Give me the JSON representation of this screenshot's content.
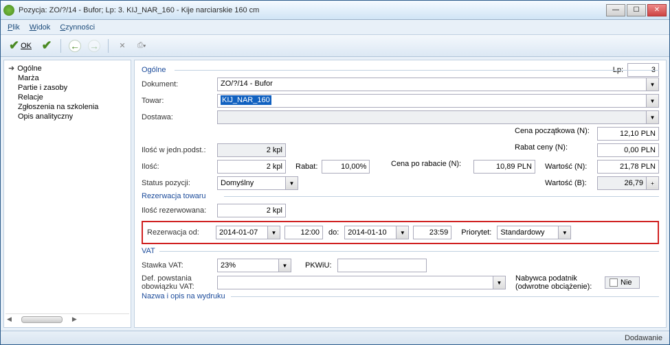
{
  "title": "Pozycja: ZO/?/14 - Bufor; Lp: 3. KIJ_NAR_160 - Kije narciarskie 160 cm",
  "menu": {
    "plik": "Plik",
    "widok": "Widok",
    "czynnosci": "Czynności"
  },
  "toolbar": {
    "ok": "OK"
  },
  "sidebar": {
    "items": [
      {
        "label": "Ogólne",
        "selected": true
      },
      {
        "label": "Marża"
      },
      {
        "label": "Partie i zasoby"
      },
      {
        "label": "Relacje"
      },
      {
        "label": "Zgłoszenia na szkolenia"
      },
      {
        "label": "Opis analityczny"
      }
    ]
  },
  "section": {
    "ogolne": "Ogólne",
    "rezerwacja": "Rezerwacja towaru",
    "vat": "VAT",
    "nazwa": "Nazwa i opis na wydruku"
  },
  "labels": {
    "lp": "Lp:",
    "dokument": "Dokument:",
    "towar": "Towar:",
    "dostawa": "Dostawa:",
    "ilosc_jedn": "Ilość w jedn.podst.:",
    "ilosc": "Ilość:",
    "rabat": "Rabat:",
    "status": "Status pozycji:",
    "cena_pocz": "Cena początkowa (N):",
    "rabat_ceny": "Rabat ceny (N):",
    "cena_po": "Cena po rabacie (N):",
    "wartosc_n": "Wartość (N):",
    "wartosc_b": "Wartość (B):",
    "ilosc_rez": "Ilość rezerwowana:",
    "rez_od": "Rezerwacja od:",
    "do": "do:",
    "priorytet": "Priorytet:",
    "stawka": "Stawka VAT:",
    "pkwiu": "PKWiU:",
    "def_vat": "Def. powstania obowiązku VAT:",
    "nabywca": "Nabywca podatnik (odwrotne obciążenie):",
    "nie": "Nie"
  },
  "values": {
    "lp": "3",
    "dokument": "ZO/?/14 - Bufor",
    "towar": "KIJ_NAR_160",
    "ilosc_jedn": "2 kpl",
    "ilosc": "2 kpl",
    "rabat": "10,00%",
    "status": "Domyślny",
    "cena_pocz": "12,10 PLN",
    "rabat_ceny": "0,00 PLN",
    "cena_po": "10,89 PLN",
    "wartosc_n": "21,78 PLN",
    "wartosc_b": "26,79",
    "ilosc_rez": "2 kpl",
    "rez_od_date": "2014-01-07",
    "rez_od_time": "12:00",
    "rez_do_date": "2014-01-10",
    "rez_do_time": "23:59",
    "priorytet": "Standardowy",
    "stawka": "23%",
    "pkwiu": "",
    "def_vat": ""
  },
  "status": "Dodawanie"
}
